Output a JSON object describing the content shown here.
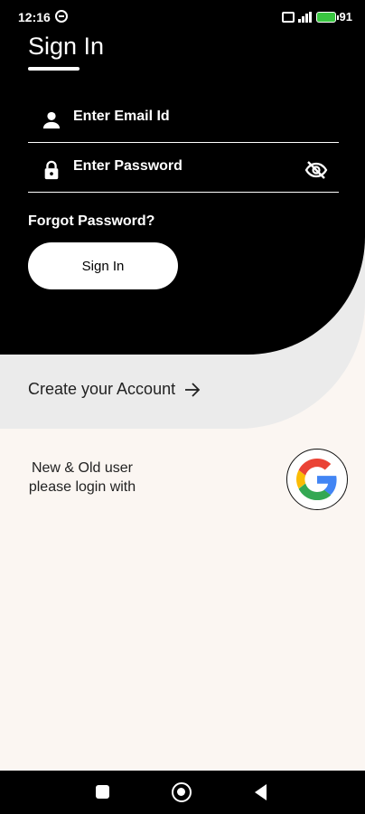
{
  "status_bar": {
    "time": "12:16",
    "battery_level": "91"
  },
  "signin": {
    "title": "Sign In",
    "email_placeholder": "Enter Email Id",
    "password_placeholder": "Enter Password",
    "forgot_label": "Forgot Password?",
    "button_label": "Sign In"
  },
  "create_account": {
    "label": "Create your Account"
  },
  "google": {
    "line1": "New & Old user",
    "line2": "please login with"
  },
  "icons": {
    "user": "user-icon",
    "lock": "lock-icon",
    "eye_off": "eye-off-icon",
    "arrow": "arrow-right-icon",
    "google": "google-icon"
  },
  "colors": {
    "header_bg": "#000000",
    "wave_bg": "#ebebeb",
    "page_bg": "#fbf6f2",
    "battery": "#39c641"
  }
}
